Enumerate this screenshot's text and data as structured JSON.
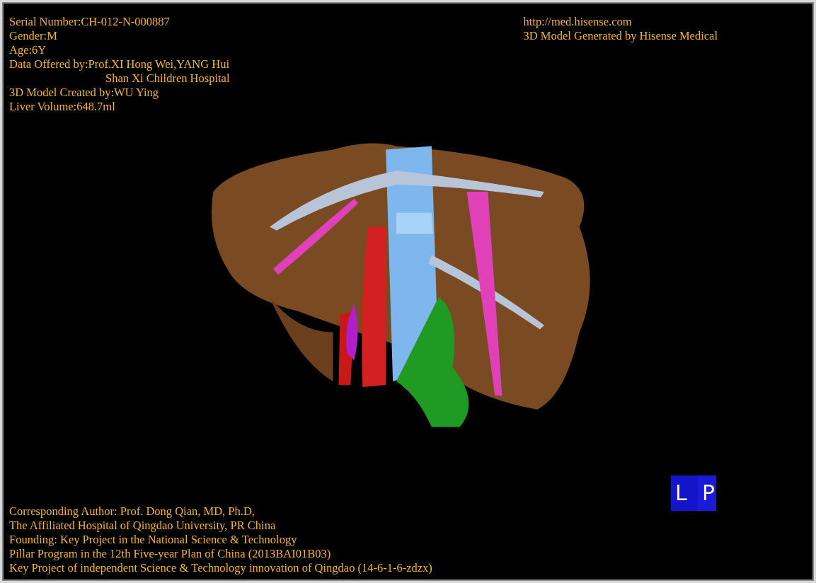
{
  "info_lines": [
    {
      "kind": "line",
      "text": "Serial Number:CH-012-N-000887"
    },
    {
      "kind": "line",
      "text": "Gender:M"
    },
    {
      "kind": "line",
      "text": "Age:6Y"
    },
    {
      "kind": "line",
      "text": "Data Offered by:Prof.XI Hong Wei,YANG Hui"
    },
    {
      "kind": "continuation",
      "text": "Shan Xi Children Hospital"
    },
    {
      "kind": "line",
      "text": "3D Model Created by:WU Ying"
    },
    {
      "kind": "line",
      "text": "Liver Volume:648.7ml"
    }
  ],
  "credit_lines": [
    "http://med.hisense.com",
    "3D Model Generated by Hisense Medical"
  ],
  "footer_lines": [
    "Corresponding Author: Prof. Dong Qian, MD, Ph.D,",
    "The Affiliated Hospital of Qingdao University, PR China",
    "Founding: Key Project in the National Science & Technology",
    "Pillar Program in the 12th Five-year Plan of China (2013BAI01B03)",
    "Key Project of independent Science & Technology innovation of Qingdao (14-6-1-6-zdzx)"
  ],
  "orientation_cube": {
    "faces": [
      "L",
      "P"
    ]
  }
}
